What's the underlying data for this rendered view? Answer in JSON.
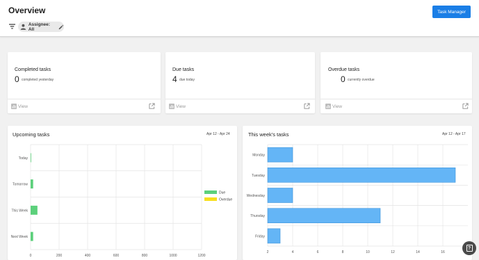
{
  "header": {
    "title": "Overview",
    "task_manager_label": "Task Manager",
    "assignee_chip": "Assignee: All"
  },
  "stats": [
    {
      "title": "Completed tasks",
      "value": "0",
      "sub": "completed yesterday",
      "view_label": "View"
    },
    {
      "title": "Due tasks",
      "value": "4",
      "sub": "due today",
      "view_label": "View"
    },
    {
      "title": "Overdue tasks",
      "value": "0",
      "sub": "currently overdue",
      "view_label": "View"
    }
  ],
  "upcoming": {
    "title": "Upcoming tasks",
    "range": "Apr 12 - Apr 24"
  },
  "week": {
    "title": "This week's tasks",
    "range": "Apr 12 - Apr 17"
  },
  "colors": {
    "accent": "#1a7ee6",
    "due": "#5cd07b",
    "overdue": "#f7df1e",
    "week_bar": "#64b5f6"
  },
  "icons": {
    "filter": "filter-icon",
    "person": "person-icon",
    "pencil": "pencil-icon",
    "chart": "bar-chart-icon",
    "external": "open-in-new-icon",
    "help": "help-icon"
  },
  "chart_data": [
    {
      "type": "bar",
      "orientation": "horizontal",
      "categories": [
        "Today",
        "Tomorrow",
        "This Week",
        "Next Week"
      ],
      "series": [
        {
          "name": "Due",
          "values": [
            4,
            18,
            48,
            18
          ]
        },
        {
          "name": "Overdue",
          "values": [
            0,
            0,
            0,
            0
          ]
        }
      ],
      "xlim": [
        0,
        1200
      ],
      "xticks": [
        0,
        200,
        400,
        600,
        800,
        1000,
        1200
      ],
      "grid": true,
      "legend": "right"
    },
    {
      "type": "bar",
      "orientation": "horizontal",
      "categories": [
        "Monday",
        "Tuesday",
        "Wednesday",
        "Thursday",
        "Friday"
      ],
      "values": [
        4,
        17,
        4,
        11,
        3
      ],
      "xlim": [
        2,
        18
      ],
      "xticks": [
        2,
        4,
        6,
        8,
        10,
        12,
        14,
        16
      ],
      "grid": true
    }
  ]
}
